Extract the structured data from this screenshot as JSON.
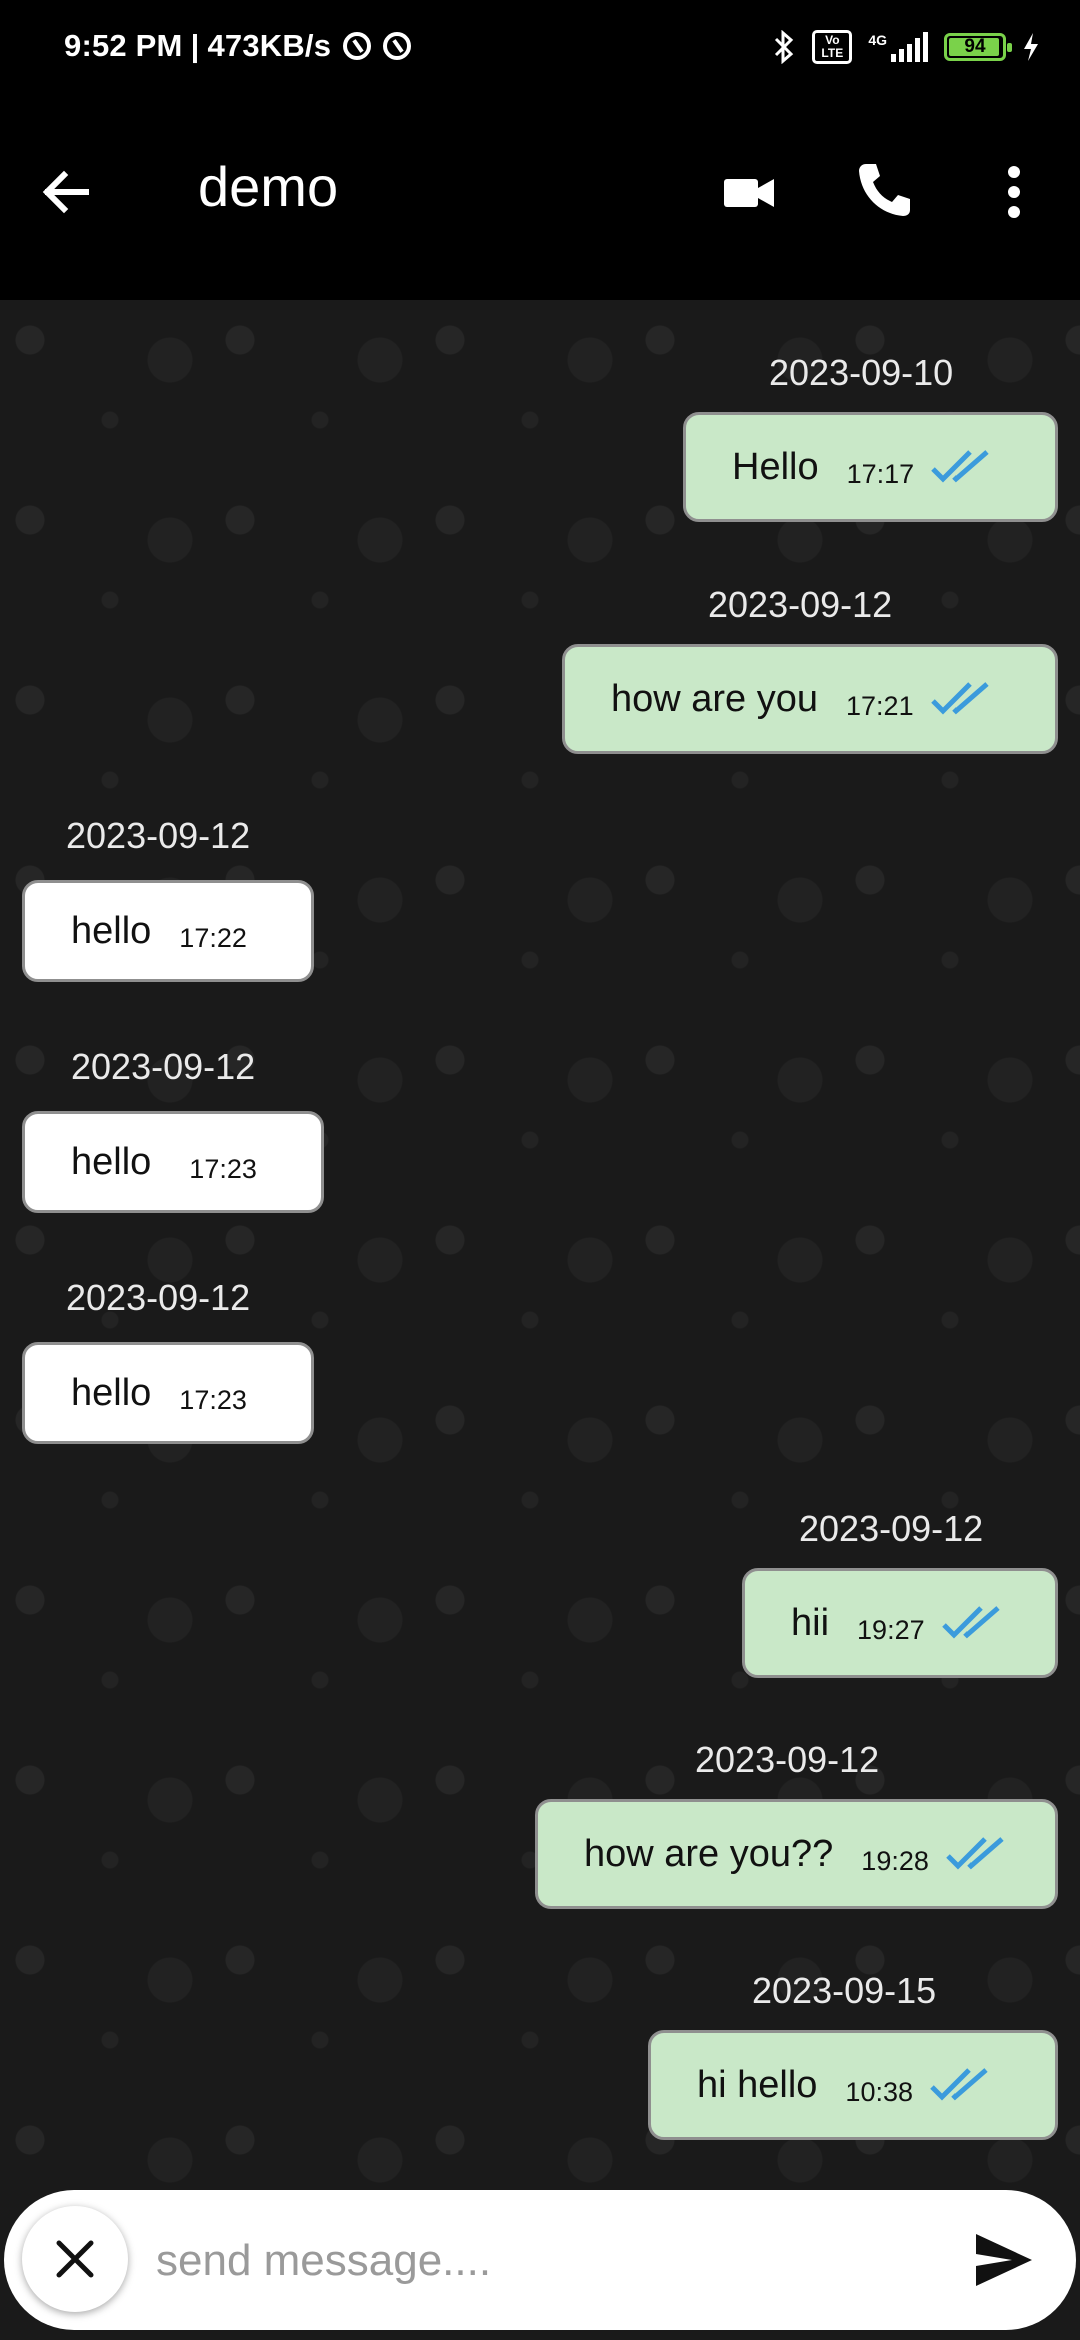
{
  "status_bar": {
    "time": "9:52 PM",
    "separator": "|",
    "speed": "473KB/s",
    "volte": "Vo LTE",
    "network": "4G",
    "battery": "94"
  },
  "header": {
    "title": "demo",
    "icons": [
      "back-arrow-icon",
      "video-call-icon",
      "phone-icon",
      "more-vert-icon"
    ]
  },
  "messages": [
    {
      "date": "2023-09-10",
      "text": "Hello",
      "time": "17:17",
      "direction": "sent"
    },
    {
      "date": "2023-09-12",
      "text": "how are you",
      "time": "17:21",
      "direction": "sent"
    },
    {
      "date": "2023-09-12",
      "text": "hello",
      "time": "17:22",
      "direction": "received"
    },
    {
      "date": "2023-09-12",
      "text": "hello",
      "time": "17:23",
      "direction": "received"
    },
    {
      "date": "2023-09-12",
      "text": "hello",
      "time": "17:23",
      "direction": "received"
    },
    {
      "date": "2023-09-12",
      "text": "hii",
      "time": "19:27",
      "direction": "sent"
    },
    {
      "date": "2023-09-12",
      "text": "how are you??",
      "time": "19:28",
      "direction": "sent"
    },
    {
      "date": "2023-09-15",
      "text": "hi hello",
      "time": "10:38",
      "direction": "sent"
    }
  ],
  "composer": {
    "placeholder": "send message....",
    "value": ""
  },
  "colors": {
    "sent_bubble": "#c9e8c8",
    "received_bubble": "#ffffff",
    "read_ticks": "#3b9bdc",
    "battery": "#7ad24a"
  }
}
